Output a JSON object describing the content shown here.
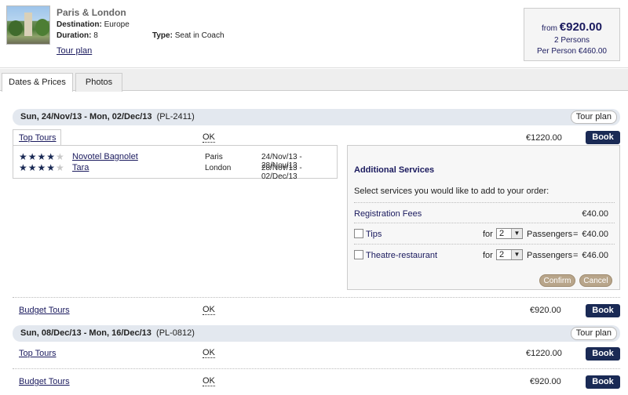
{
  "header": {
    "title": "Paris & London",
    "destination_label": "Destination:",
    "destination_value": "Europe",
    "duration_label": "Duration:",
    "duration_value": "8",
    "type_label": "Type:",
    "type_value": "Seat in Coach",
    "tour_plan_link": "Tour plan"
  },
  "price_box": {
    "from_label": "from",
    "amount": "€920.00",
    "persons": "2 Persons",
    "per_person": "Per Person €460.00"
  },
  "tabs": [
    {
      "label": "Dates & Prices",
      "active": true
    },
    {
      "label": "Photos",
      "active": false
    }
  ],
  "dates": [
    {
      "range": "Sun, 24/Nov/13 - Mon, 02/Dec/13",
      "code": "(PL-2411)",
      "tour_plan_label": "Tour plan",
      "tiers": [
        {
          "name": "Top Tours",
          "status": "OK",
          "price": "€1220.00",
          "book_label": "Book",
          "hotels": [
            {
              "stars": 4,
              "name": "Novotel Bagnolet",
              "city": "Paris",
              "dates": "24/Nov/13 - 28/Nov/13"
            },
            {
              "stars": 4,
              "name": "Tara",
              "city": "London",
              "dates": "28/Nov/13 - 02/Dec/13"
            }
          ]
        },
        {
          "name": "Budget Tours",
          "status": "OK",
          "price": "€920.00",
          "book_label": "Book"
        }
      ]
    },
    {
      "range": "Sun, 08/Dec/13 - Mon, 16/Dec/13",
      "code": "(PL-0812)",
      "tour_plan_label": "Tour plan",
      "tiers": [
        {
          "name": "Top Tours",
          "status": "OK",
          "price": "€1220.00",
          "book_label": "Book"
        },
        {
          "name": "Budget Tours",
          "status": "OK",
          "price": "€920.00",
          "book_label": "Book"
        }
      ]
    }
  ],
  "services": {
    "title": "Additional Services",
    "hint": "Select services you would like to add to your order:",
    "registration": {
      "label": "Registration Fees",
      "amount": "€40.00"
    },
    "items": [
      {
        "label": "Tips",
        "for_label": "for",
        "qty": "2",
        "passengers_label": "Passengers",
        "eq": "=",
        "amount": "€40.00"
      },
      {
        "label": "Theatre-restaurant",
        "for_label": "for",
        "qty": "2",
        "passengers_label": "Passengers",
        "eq": "=",
        "amount": "€46.00"
      }
    ],
    "confirm_label": "Confirm",
    "cancel_label": "Cancel"
  },
  "icons": {
    "star_filled": "★",
    "star_empty": "★",
    "dropdown": "▼"
  },
  "colors": {
    "navy": "#1a2a55",
    "tan_button": "#b8a58a",
    "date_bar": "#e3e8ef"
  }
}
